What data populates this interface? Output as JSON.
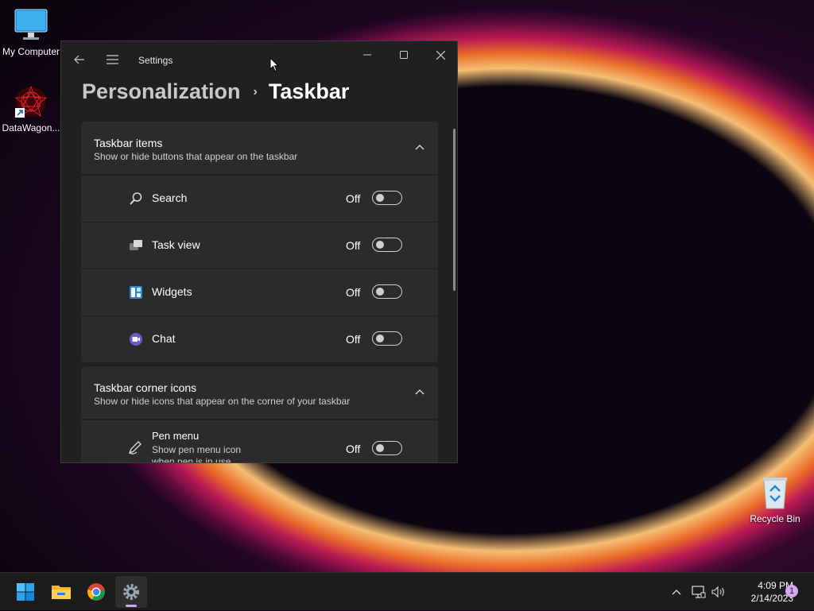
{
  "desktop": {
    "icons": [
      {
        "label": "My Computer",
        "icon": "monitor-icon"
      },
      {
        "label": "DataWagon...",
        "icon": "datawagon-shortcut-icon"
      },
      {
        "label": "Recycle Bin",
        "icon": "recycle-bin-icon"
      }
    ]
  },
  "settings": {
    "app_title": "Settings",
    "breadcrumb": {
      "parent": "Personalization",
      "current": "Taskbar"
    },
    "taskbar_items": {
      "title": "Taskbar items",
      "subtitle": "Show or hide buttons that appear on the taskbar",
      "items": [
        {
          "label": "Search",
          "state": "Off",
          "icon": "search-icon"
        },
        {
          "label": "Task view",
          "state": "Off",
          "icon": "task-view-icon"
        },
        {
          "label": "Widgets",
          "state": "Off",
          "icon": "widgets-icon"
        },
        {
          "label": "Chat",
          "state": "Off",
          "icon": "chat-icon"
        }
      ]
    },
    "corner_icons": {
      "title": "Taskbar corner icons",
      "subtitle": "Show or hide icons that appear on the corner of your taskbar",
      "items": [
        {
          "label": "Pen menu",
          "description": "Show pen menu icon when pen is in use",
          "state": "Off",
          "icon": "pen-icon"
        }
      ]
    }
  },
  "taskbar": {
    "apps": [
      "start-icon",
      "file-explorer-icon",
      "chrome-icon",
      "settings-icon"
    ],
    "clock": {
      "time": "4:09 PM",
      "date": "2/14/2023"
    },
    "notification_count": "1"
  },
  "colors": {
    "window_bg": "#202020",
    "card_bg": "#2b2b2b",
    "taskbar_bg": "#1c1c1c",
    "accent": "#0078d4"
  }
}
